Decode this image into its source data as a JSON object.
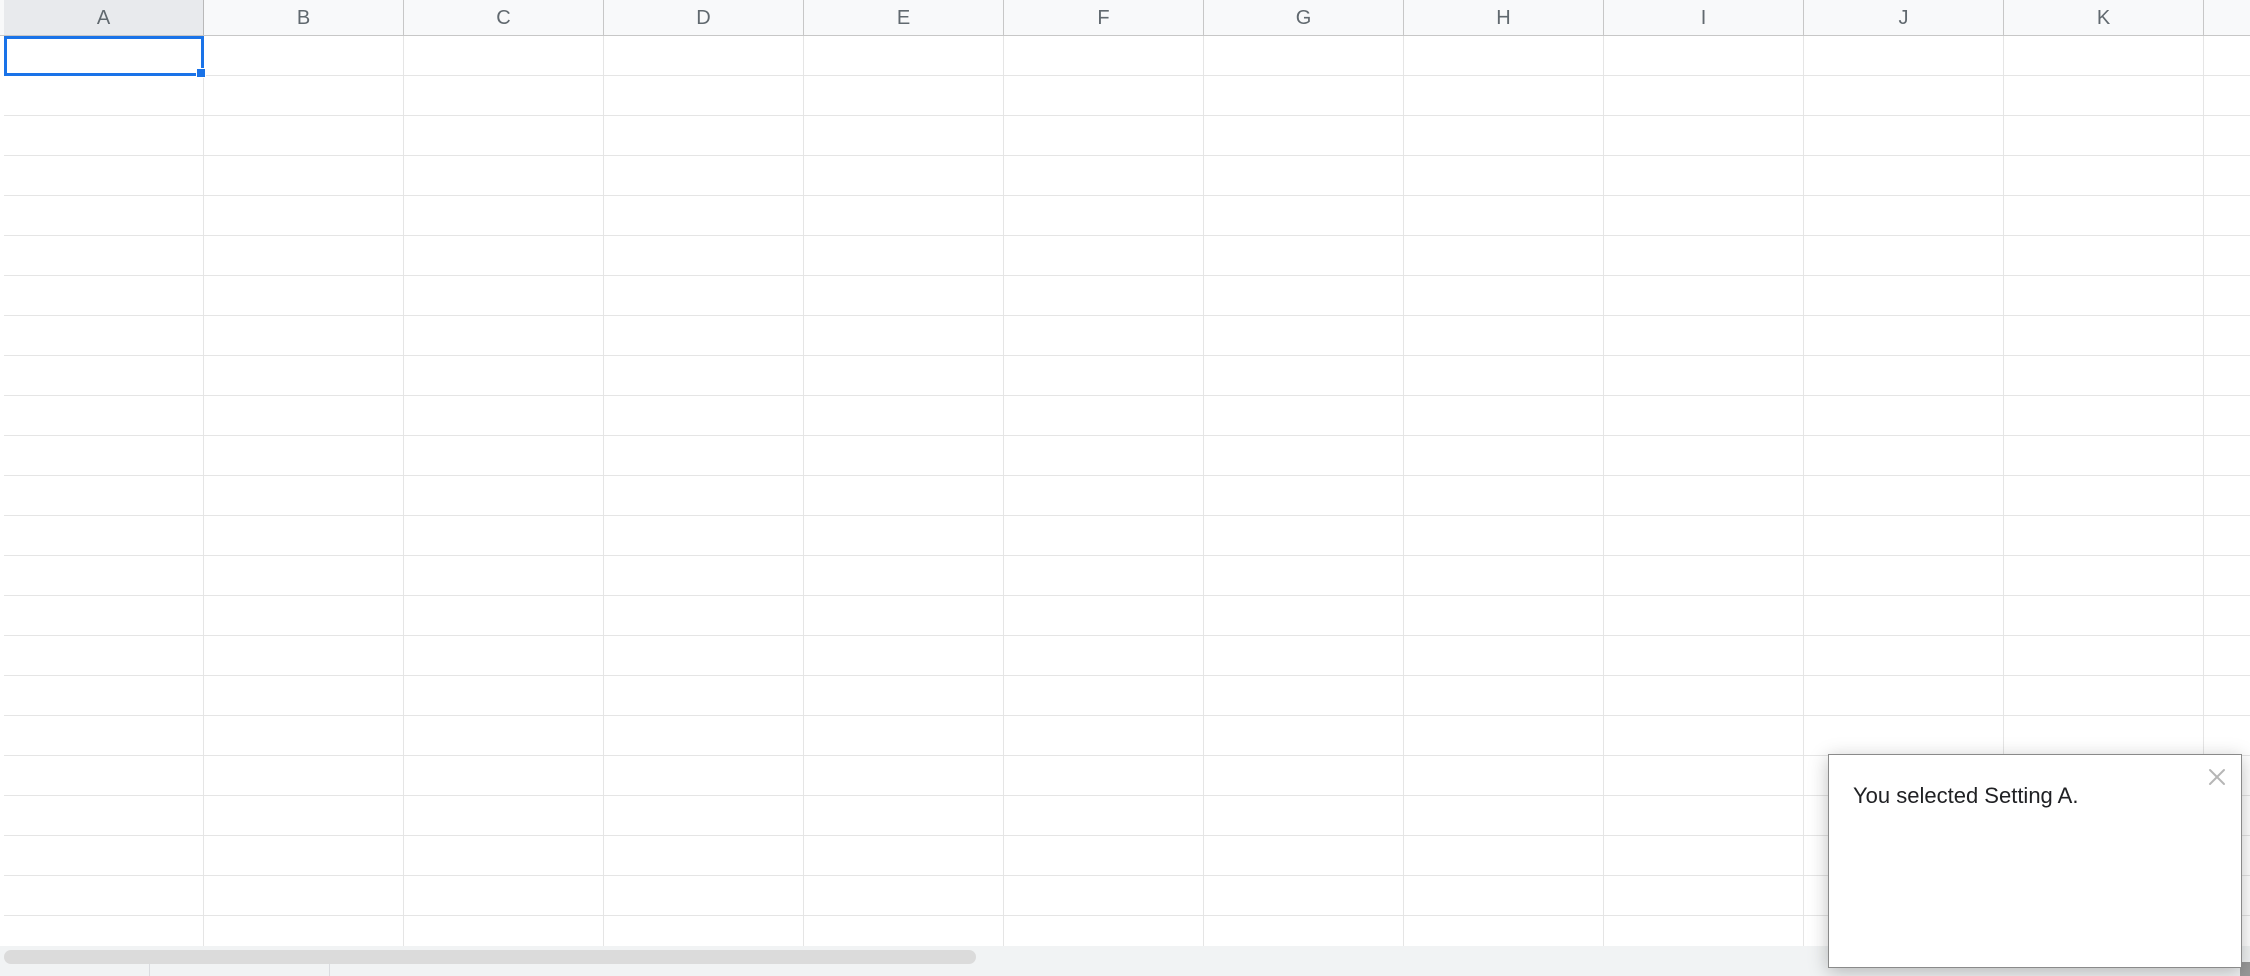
{
  "columns": [
    "A",
    "B",
    "C",
    "D",
    "E",
    "F",
    "G",
    "H",
    "I",
    "J",
    "K"
  ],
  "active_column_index": 0,
  "active_cell": "A1",
  "visible_row_count": 23,
  "toast": {
    "message": "You selected Setting A.",
    "close_title": "Close"
  }
}
